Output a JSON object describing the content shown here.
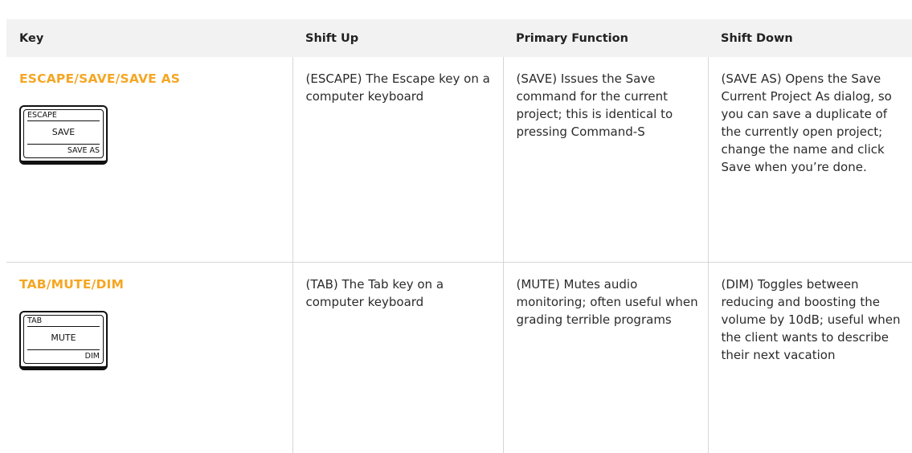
{
  "table": {
    "headers": {
      "key": "Key",
      "shift_up": "Shift Up",
      "primary": "Primary Function",
      "shift_down": "Shift Down"
    },
    "rows": [
      {
        "key_name": "ESCAPE/SAVE/SAVE AS",
        "keycap": {
          "top": "ESCAPE",
          "middle": "SAVE",
          "bottom": "SAVE AS"
        },
        "shift_up": "(ESCAPE) The Escape key on a computer keyboard",
        "primary": "(SAVE) Issues the Save command for the current project; this is identical to pressing Command-S",
        "shift_down": "(SAVE AS) Opens the Save Current Project As dialog, so you can save a duplicate of the currently open project; change the name and click Save when you’re done."
      },
      {
        "key_name": "TAB/MUTE/DIM",
        "keycap": {
          "top": "TAB",
          "middle": "MUTE",
          "bottom": "DIM"
        },
        "shift_up": "(TAB) The Tab key on a computer keyboard",
        "primary": "(MUTE) Mutes audio monitoring; often useful when grading terrible programs",
        "shift_down": "(DIM) Toggles between reducing and boosting the volume by 10dB; useful when the client wants to describe their next vacation"
      }
    ]
  },
  "colors": {
    "key_name": "#f5a623",
    "header_bg": "#f2f2f2",
    "divider": "#d6d6d6"
  }
}
